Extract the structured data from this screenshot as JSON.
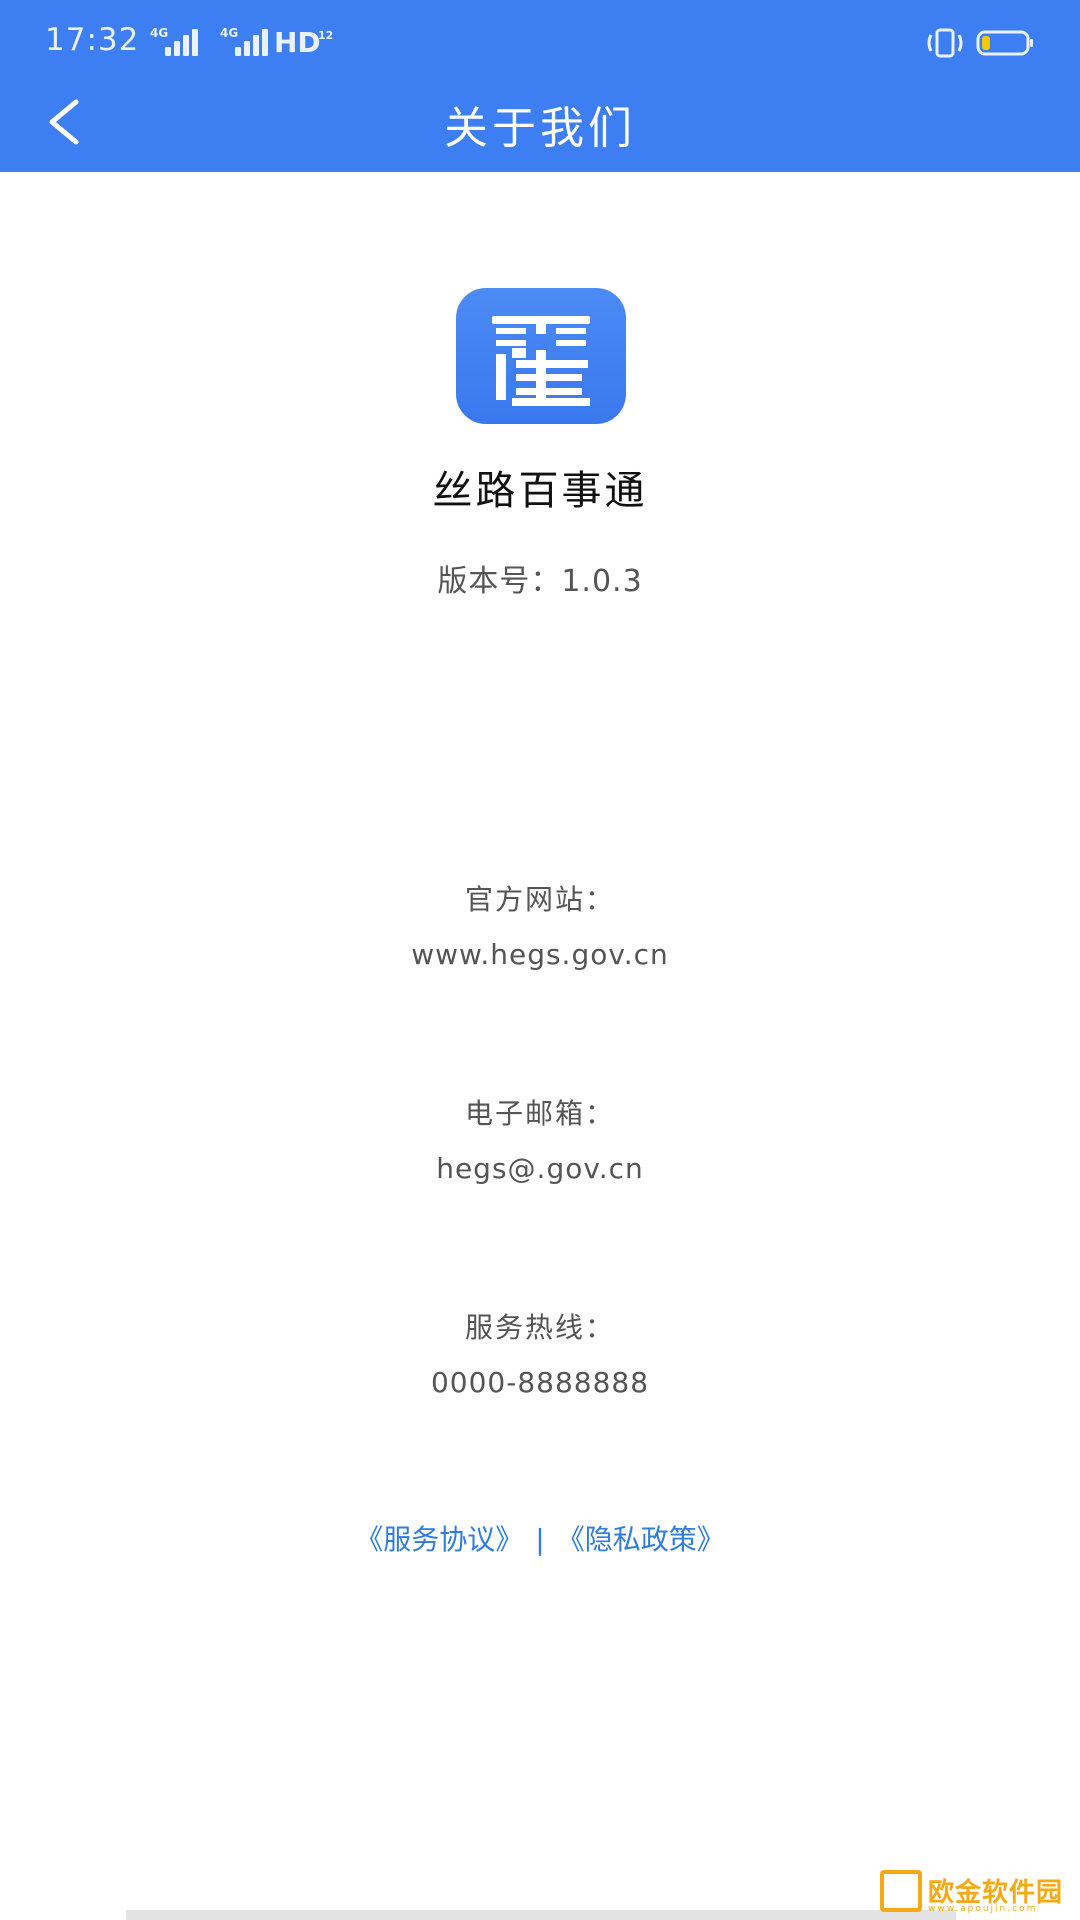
{
  "status_bar": {
    "time": "17:32",
    "network_1": "4G",
    "network_2": "4G",
    "hd_label": "HD",
    "hd_sub": "12",
    "icons": [
      "vibrate-icon",
      "battery-icon"
    ],
    "battery_level": 0.15,
    "battery_color": "#f5c800"
  },
  "header": {
    "title": "关于我们",
    "back_icon": "chevron-left-icon",
    "color": "#3d7ef2"
  },
  "app": {
    "logo": "app-logo",
    "name": "丝路百事通",
    "version": "版本号：1.0.3"
  },
  "info": {
    "website_label": "官方网站：",
    "website_value": "www.hegs.gov.cn",
    "email_label": "电子邮箱：",
    "email_value": "hegs@.gov.cn",
    "hotline_label": "服务热线：",
    "hotline_value": "0000-8888888"
  },
  "links": {
    "service_agreement": "《服务协议》",
    "separator": "|",
    "privacy_policy": "《隐私政策》",
    "color": "#2f7de1"
  },
  "watermark": {
    "text": "欧金软件园",
    "url": "www.apoujin.com"
  }
}
